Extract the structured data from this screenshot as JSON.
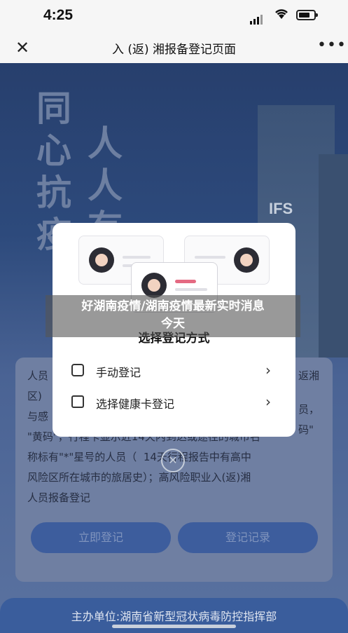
{
  "status_bar": {
    "time": "4:25"
  },
  "nav": {
    "close_icon": "close-icon",
    "title": "入 (返) 湘报备登记页面",
    "more_icon": "more-icon"
  },
  "poster": {
    "slogan_chars": [
      "同",
      "心",
      "抗",
      "疫",
      "人",
      "人",
      "有"
    ],
    "building_sign": "IFS"
  },
  "background_card": {
    "lines": [
      "人员",
      "区)",
      "与感",
      "\"黄码\"，行程卡显示近14天内到达或途径的城市名",
      "称标有\"*\"星号的人员（  14天行程报告中有高中",
      "风险区所在城市的旅居史）；高风险职业入(返)湘",
      "人员报备登记"
    ],
    "right_fragments": [
      "返湘",
      "员，",
      "码\""
    ],
    "primary_button": "立即登记",
    "secondary_button": "登记记录"
  },
  "footer": {
    "organizer": "主办单位:湖南省新型冠状病毒防控指挥部"
  },
  "modal": {
    "title": "选择登记方式",
    "options": [
      {
        "label": "手动登记",
        "icon": "edit-icon"
      },
      {
        "label": "选择健康卡登记",
        "icon": "card-icon"
      }
    ],
    "dismiss_icon": "close-icon"
  },
  "watermark": {
    "line1": "好湖南疫情/湖南疫情最新实时消息",
    "line2": "今天"
  }
}
